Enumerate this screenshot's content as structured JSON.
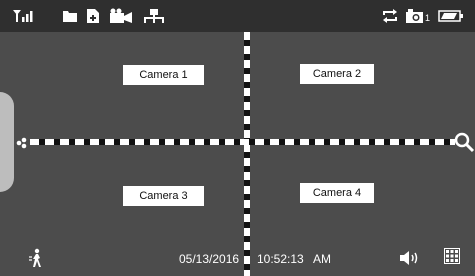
{
  "status_bar": {
    "icons": [
      "signal-icon",
      "folder-icon",
      "add-file-icon",
      "camera-switch-icon",
      "network-icon",
      "repeat-icon",
      "snapshot-icon",
      "battery-icon"
    ],
    "snapshot_count": "1"
  },
  "cameras": [
    {
      "label": "Camera 1"
    },
    {
      "label": "Camera 2"
    },
    {
      "label": "Camera 3"
    },
    {
      "label": "Camera 4"
    }
  ],
  "bottom_bar": {
    "date": "05/13/2016",
    "time": "10:52:13",
    "meridiem": "AM",
    "icons": [
      "motion-person-icon",
      "volume-icon",
      "grid-icon"
    ]
  },
  "colors": {
    "screen_bg": "#4c4c4c",
    "status_bg": "#2f2f2f",
    "icon": "#ffffff",
    "divider_light": "#ffffff",
    "divider_dark": "#111111"
  }
}
